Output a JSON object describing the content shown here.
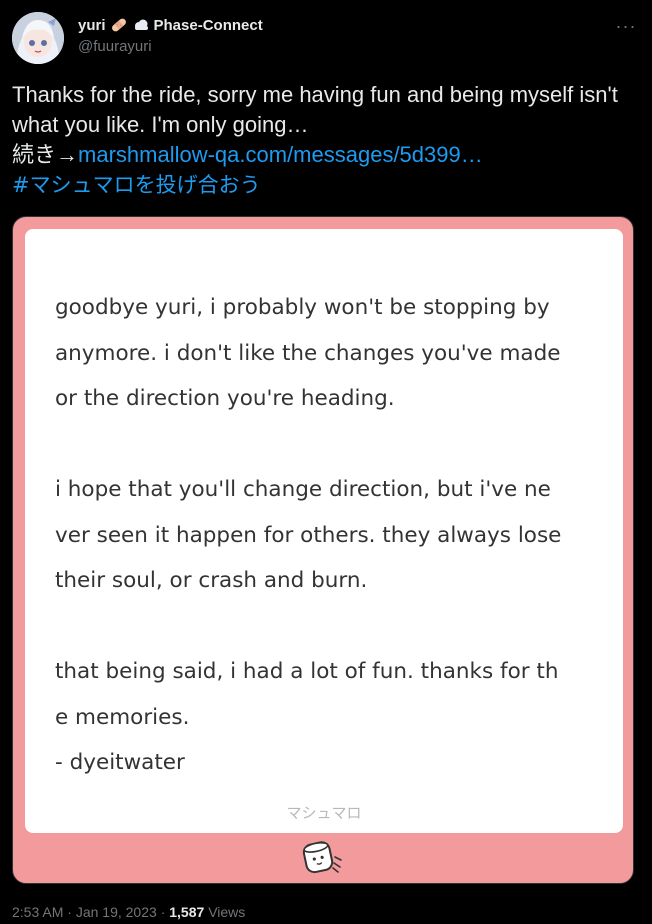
{
  "author": {
    "display_name": "yuri",
    "affiliation": "Phase-Connect",
    "handle": "@fuurayuri",
    "emoji_icons": [
      "bandage-icon",
      "cloud-icon"
    ]
  },
  "menu": {
    "more_label": "···"
  },
  "tweet": {
    "text": "Thanks for the ride, sorry me having fun and being myself isn't what you like. I'm only going…",
    "continuation_prefix": "続き→",
    "link_text": "marshmallow-qa.com/messages/5d399…",
    "hashtag": "#マシュマロを投げ合おう"
  },
  "card": {
    "message": "goodbye yuri, i probably won't be stopping by\nanymore. i don't like the changes you've made\nor the direction you're heading.\n\ni hope that you'll change direction, but i've ne\nver seen it happen for others. they always lose\ntheir soul, or crash and burn.\n\nthat being said, i had a lot of fun. thanks for th\ne memories.\n- dyeitwater",
    "brand": "マシュマロ",
    "icon": "marshmallow-icon",
    "background_color": "#f29a9c"
  },
  "meta": {
    "time": "2:53 AM",
    "separator": "·",
    "date": "Jan 19, 2023",
    "views_count": "1,587",
    "views_label": "Views"
  },
  "colors": {
    "link": "#1d9bf0",
    "secondary_text": "#71767b",
    "background": "#000000"
  }
}
